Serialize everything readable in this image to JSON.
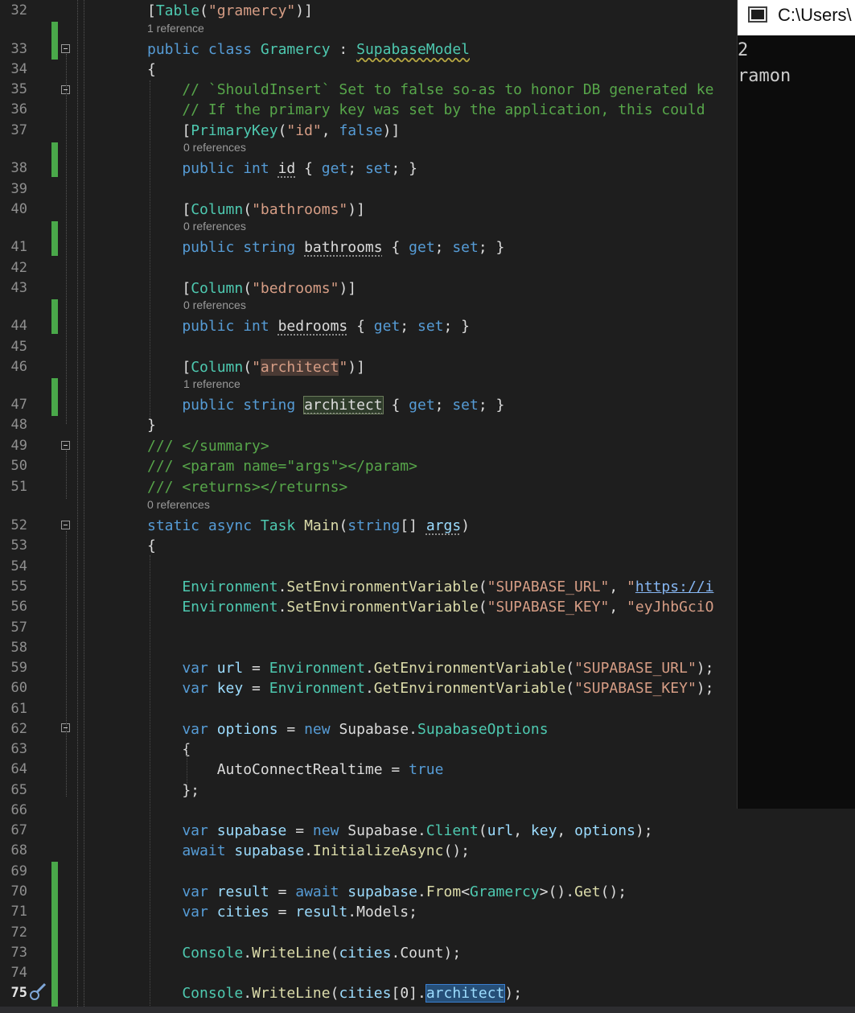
{
  "editor": {
    "lines": [
      {
        "num": "32",
        "tokens": [
          {
            "c": "",
            "t": "["
          },
          {
            "c": "ty",
            "t": "Table"
          },
          {
            "c": "",
            "t": "("
          },
          {
            "c": "st",
            "t": "\"gramercy\""
          },
          {
            "c": "",
            "t": ")]"
          }
        ]
      },
      {
        "num": "33",
        "lens": "1 reference",
        "tokens": [
          {
            "c": "kw",
            "t": "public class "
          },
          {
            "c": "ty",
            "t": "Gramercy"
          },
          {
            "c": "",
            "t": " : "
          },
          {
            "c": "ty squig",
            "t": "SupabaseModel"
          }
        ]
      },
      {
        "num": "34",
        "tokens": [
          {
            "c": "",
            "t": "{"
          }
        ]
      },
      {
        "num": "35",
        "tokens": [
          {
            "c": "cm",
            "t": "    // `ShouldInsert` Set to false so-as to honor DB generated ke"
          }
        ]
      },
      {
        "num": "36",
        "tokens": [
          {
            "c": "cm",
            "t": "    // If the primary key was set by the application, this could"
          }
        ]
      },
      {
        "num": "37",
        "tokens": [
          {
            "c": "",
            "t": "    ["
          },
          {
            "c": "ty",
            "t": "PrimaryKey"
          },
          {
            "c": "",
            "t": "("
          },
          {
            "c": "st",
            "t": "\"id\""
          },
          {
            "c": "",
            "t": ", "
          },
          {
            "c": "kw",
            "t": "false"
          },
          {
            "c": "",
            "t": ")]"
          }
        ]
      },
      {
        "num": "38",
        "lens": "0 references",
        "tokens": [
          {
            "c": "kw",
            "t": "    public int "
          },
          {
            "c": "dots",
            "t": "id"
          },
          {
            "c": "",
            "t": " { "
          },
          {
            "c": "kw",
            "t": "get"
          },
          {
            "c": "",
            "t": "; "
          },
          {
            "c": "kw",
            "t": "set"
          },
          {
            "c": "",
            "t": "; }"
          }
        ]
      },
      {
        "num": "39",
        "tokens": []
      },
      {
        "num": "40",
        "tokens": [
          {
            "c": "",
            "t": "    ["
          },
          {
            "c": "ty",
            "t": "Column"
          },
          {
            "c": "",
            "t": "("
          },
          {
            "c": "st",
            "t": "\"bathrooms\""
          },
          {
            "c": "",
            "t": ")]"
          }
        ]
      },
      {
        "num": "41",
        "lens": "0 references",
        "tokens": [
          {
            "c": "kw",
            "t": "    public string "
          },
          {
            "c": "dots",
            "t": "bathrooms"
          },
          {
            "c": "",
            "t": " { "
          },
          {
            "c": "kw",
            "t": "get"
          },
          {
            "c": "",
            "t": "; "
          },
          {
            "c": "kw",
            "t": "set"
          },
          {
            "c": "",
            "t": "; }"
          }
        ]
      },
      {
        "num": "42",
        "tokens": []
      },
      {
        "num": "43",
        "tokens": [
          {
            "c": "",
            "t": "    ["
          },
          {
            "c": "ty",
            "t": "Column"
          },
          {
            "c": "",
            "t": "("
          },
          {
            "c": "st",
            "t": "\"bedrooms\""
          },
          {
            "c": "",
            "t": ")]"
          }
        ]
      },
      {
        "num": "44",
        "lens": "0 references",
        "tokens": [
          {
            "c": "kw",
            "t": "    public int "
          },
          {
            "c": "dots",
            "t": "bedrooms"
          },
          {
            "c": "",
            "t": " { "
          },
          {
            "c": "kw",
            "t": "get"
          },
          {
            "c": "",
            "t": "; "
          },
          {
            "c": "kw",
            "t": "set"
          },
          {
            "c": "",
            "t": "; }"
          }
        ]
      },
      {
        "num": "45",
        "tokens": []
      },
      {
        "num": "46",
        "tokens": [
          {
            "c": "",
            "t": "    ["
          },
          {
            "c": "ty",
            "t": "Column"
          },
          {
            "c": "",
            "t": "("
          },
          {
            "c": "st",
            "t": "\""
          },
          {
            "c": "st hl-str",
            "t": "architect"
          },
          {
            "c": "st",
            "t": "\""
          },
          {
            "c": "",
            "t": ")]"
          }
        ]
      },
      {
        "num": "47",
        "lens": "1 reference",
        "tokens": [
          {
            "c": "kw",
            "t": "    public string "
          },
          {
            "c": "hl-box dots",
            "t": "architect"
          },
          {
            "c": "",
            "t": " { "
          },
          {
            "c": "kw",
            "t": "get"
          },
          {
            "c": "",
            "t": "; "
          },
          {
            "c": "kw",
            "t": "set"
          },
          {
            "c": "",
            "t": "; }"
          }
        ]
      },
      {
        "num": "48",
        "tokens": [
          {
            "c": "",
            "t": "}"
          }
        ]
      },
      {
        "num": "49",
        "tokens": [
          {
            "c": "cm",
            "t": "/// </summary>"
          }
        ]
      },
      {
        "num": "50",
        "tokens": [
          {
            "c": "cm",
            "t": "/// <param name=\"args\"></param>"
          }
        ]
      },
      {
        "num": "51",
        "tokens": [
          {
            "c": "cm",
            "t": "/// <returns></returns>"
          }
        ]
      },
      {
        "num": "52",
        "lens": "0 references",
        "tokens": [
          {
            "c": "kw",
            "t": "static async "
          },
          {
            "c": "ty",
            "t": "Task"
          },
          {
            "c": "",
            "t": " "
          },
          {
            "c": "fn",
            "t": "Main"
          },
          {
            "c": "",
            "t": "("
          },
          {
            "c": "kw",
            "t": "string"
          },
          {
            "c": "",
            "t": "[] "
          },
          {
            "c": "ident dots",
            "t": "args"
          },
          {
            "c": "",
            "t": ")"
          }
        ]
      },
      {
        "num": "53",
        "tokens": [
          {
            "c": "",
            "t": "{"
          }
        ]
      },
      {
        "num": "54",
        "tokens": []
      },
      {
        "num": "55",
        "tokens": [
          {
            "c": "ty",
            "t": "    Environment"
          },
          {
            "c": "",
            "t": "."
          },
          {
            "c": "fn",
            "t": "SetEnvironmentVariable"
          },
          {
            "c": "",
            "t": "("
          },
          {
            "c": "st",
            "t": "\"SUPABASE_URL\""
          },
          {
            "c": "",
            "t": ", "
          },
          {
            "c": "st",
            "t": "\""
          },
          {
            "c": "link",
            "t": "https://i"
          }
        ]
      },
      {
        "num": "56",
        "tokens": [
          {
            "c": "ty",
            "t": "    Environment"
          },
          {
            "c": "",
            "t": "."
          },
          {
            "c": "fn",
            "t": "SetEnvironmentVariable"
          },
          {
            "c": "",
            "t": "("
          },
          {
            "c": "st",
            "t": "\"SUPABASE_KEY\""
          },
          {
            "c": "",
            "t": ", "
          },
          {
            "c": "st",
            "t": "\"eyJhbGciO"
          }
        ]
      },
      {
        "num": "57",
        "tokens": []
      },
      {
        "num": "58",
        "tokens": []
      },
      {
        "num": "59",
        "tokens": [
          {
            "c": "kw",
            "t": "    var "
          },
          {
            "c": "ident",
            "t": "url"
          },
          {
            "c": "",
            "t": " = "
          },
          {
            "c": "ty",
            "t": "Environment"
          },
          {
            "c": "",
            "t": "."
          },
          {
            "c": "fn",
            "t": "GetEnvironmentVariable"
          },
          {
            "c": "",
            "t": "("
          },
          {
            "c": "st",
            "t": "\"SUPABASE_URL\""
          },
          {
            "c": "",
            "t": ");"
          }
        ]
      },
      {
        "num": "60",
        "tokens": [
          {
            "c": "kw",
            "t": "    var "
          },
          {
            "c": "ident",
            "t": "key"
          },
          {
            "c": "",
            "t": " = "
          },
          {
            "c": "ty",
            "t": "Environment"
          },
          {
            "c": "",
            "t": "."
          },
          {
            "c": "fn",
            "t": "GetEnvironmentVariable"
          },
          {
            "c": "",
            "t": "("
          },
          {
            "c": "st",
            "t": "\"SUPABASE_KEY\""
          },
          {
            "c": "",
            "t": ");"
          }
        ]
      },
      {
        "num": "61",
        "tokens": []
      },
      {
        "num": "62",
        "tokens": [
          {
            "c": "kw",
            "t": "    var "
          },
          {
            "c": "ident",
            "t": "options"
          },
          {
            "c": "",
            "t": " = "
          },
          {
            "c": "kw",
            "t": "new "
          },
          {
            "c": "",
            "t": "Supabase."
          },
          {
            "c": "ty",
            "t": "SupabaseOptions"
          }
        ]
      },
      {
        "num": "63",
        "tokens": [
          {
            "c": "",
            "t": "    {"
          }
        ]
      },
      {
        "num": "64",
        "tokens": [
          {
            "c": "",
            "t": "        AutoConnectRealtime = "
          },
          {
            "c": "kw",
            "t": "true"
          }
        ]
      },
      {
        "num": "65",
        "tokens": [
          {
            "c": "",
            "t": "    };"
          }
        ]
      },
      {
        "num": "66",
        "tokens": []
      },
      {
        "num": "67",
        "tokens": [
          {
            "c": "kw",
            "t": "    var "
          },
          {
            "c": "ident",
            "t": "supabase"
          },
          {
            "c": "",
            "t": " = "
          },
          {
            "c": "kw",
            "t": "new "
          },
          {
            "c": "",
            "t": "Supabase."
          },
          {
            "c": "ty",
            "t": "Client"
          },
          {
            "c": "",
            "t": "("
          },
          {
            "c": "ident",
            "t": "url"
          },
          {
            "c": "",
            "t": ", "
          },
          {
            "c": "ident",
            "t": "key"
          },
          {
            "c": "",
            "t": ", "
          },
          {
            "c": "ident",
            "t": "options"
          },
          {
            "c": "",
            "t": ");"
          }
        ]
      },
      {
        "num": "68",
        "tokens": [
          {
            "c": "kw",
            "t": "    await "
          },
          {
            "c": "ident",
            "t": "supabase"
          },
          {
            "c": "",
            "t": "."
          },
          {
            "c": "fn",
            "t": "InitializeAsync"
          },
          {
            "c": "",
            "t": "();"
          }
        ]
      },
      {
        "num": "69",
        "tokens": []
      },
      {
        "num": "70",
        "tokens": [
          {
            "c": "kw",
            "t": "    var "
          },
          {
            "c": "ident",
            "t": "result"
          },
          {
            "c": "",
            "t": " = "
          },
          {
            "c": "kw",
            "t": "await "
          },
          {
            "c": "ident",
            "t": "supabase"
          },
          {
            "c": "",
            "t": "."
          },
          {
            "c": "fn",
            "t": "From"
          },
          {
            "c": "",
            "t": "<"
          },
          {
            "c": "ty",
            "t": "Gramercy"
          },
          {
            "c": "",
            "t": ">()."
          },
          {
            "c": "fn",
            "t": "Get"
          },
          {
            "c": "",
            "t": "();"
          }
        ]
      },
      {
        "num": "71",
        "tokens": [
          {
            "c": "kw",
            "t": "    var "
          },
          {
            "c": "ident",
            "t": "cities"
          },
          {
            "c": "",
            "t": " = "
          },
          {
            "c": "ident",
            "t": "result"
          },
          {
            "c": "",
            "t": "."
          },
          {
            "c": "",
            "t": "Models;"
          }
        ]
      },
      {
        "num": "72",
        "tokens": []
      },
      {
        "num": "73",
        "tokens": [
          {
            "c": "ty",
            "t": "    Console"
          },
          {
            "c": "",
            "t": "."
          },
          {
            "c": "fn",
            "t": "WriteLine"
          },
          {
            "c": "",
            "t": "("
          },
          {
            "c": "ident",
            "t": "cities"
          },
          {
            "c": "",
            "t": ".Count);"
          }
        ]
      },
      {
        "num": "74",
        "tokens": []
      },
      {
        "num": "75",
        "current": true,
        "tokens": [
          {
            "c": "ty",
            "t": "    Console"
          },
          {
            "c": "",
            "t": "."
          },
          {
            "c": "fn",
            "t": "WriteLine"
          },
          {
            "c": "",
            "t": "("
          },
          {
            "c": "ident",
            "t": "cities"
          },
          {
            "c": "",
            "t": "[0]."
          },
          {
            "c": "ident sel",
            "t": "architect"
          },
          {
            "c": "",
            "t": ");"
          }
        ]
      }
    ]
  },
  "console": {
    "title": "C:\\Users\\",
    "output": [
      "2",
      "ramon"
    ],
    "icon": "console-window-icon"
  },
  "colors": {
    "background": "#1e1e1e",
    "keyword": "#569cd6",
    "type": "#4ec9b0",
    "string": "#d69d85",
    "comment": "#57a64a",
    "change_bar": "#4aa84a"
  }
}
